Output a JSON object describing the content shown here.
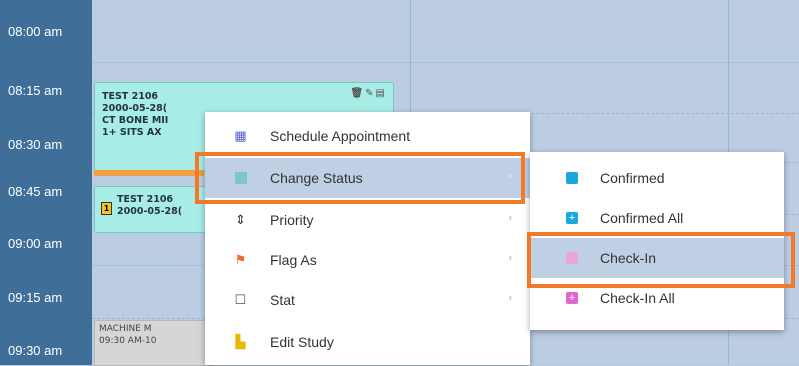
{
  "times": [
    "08:00 am",
    "08:15 am",
    "08:30 am",
    "08:45 am",
    "09:00 am",
    "09:15 am",
    "09:30 am"
  ],
  "appointments": [
    {
      "lines": [
        "TEST 2106",
        "2000-05-28(",
        "CT BONE MII",
        "1+ SITS AX"
      ],
      "icons": "🗑✎▤"
    },
    {
      "badge": "1",
      "lines": [
        "TEST 2106",
        "2000-05-28("
      ]
    }
  ],
  "machine": {
    "lines": [
      "MACHINE M",
      "09:30 AM-10"
    ]
  },
  "context_menu": {
    "items": [
      {
        "label": "Schedule Appointment",
        "icon": "calendar-icon",
        "color": "#5b5bd6"
      },
      {
        "label": "Change Status",
        "icon": "status-square-icon",
        "color": "#7ec8c4",
        "arrow": "›"
      },
      {
        "label": "Priority",
        "icon": "sort-icon",
        "color": "#333333",
        "arrow": "›"
      },
      {
        "label": "Flag As",
        "icon": "flag-icon",
        "color": "#f06a2a",
        "arrow": "›"
      },
      {
        "label": "Stat",
        "icon": "checkbox-icon",
        "color": "#555555",
        "arrow": "›"
      },
      {
        "label": "Edit Study",
        "icon": "edit-study-icon",
        "color": "#e6b800"
      }
    ]
  },
  "status_submenu": {
    "items": [
      {
        "label": "Confirmed",
        "icon": "confirmed-square-icon",
        "color": "#19a7e0"
      },
      {
        "label": "Confirmed All",
        "icon": "confirmed-all-icon",
        "color": "#19a7e0"
      },
      {
        "label": "Check-In",
        "icon": "checkin-square-icon",
        "color": "#e9a6d9"
      },
      {
        "label": "Check-In All",
        "icon": "checkin-all-icon",
        "color": "#e067d0"
      }
    ]
  },
  "highlight_color": "#f07a2a"
}
